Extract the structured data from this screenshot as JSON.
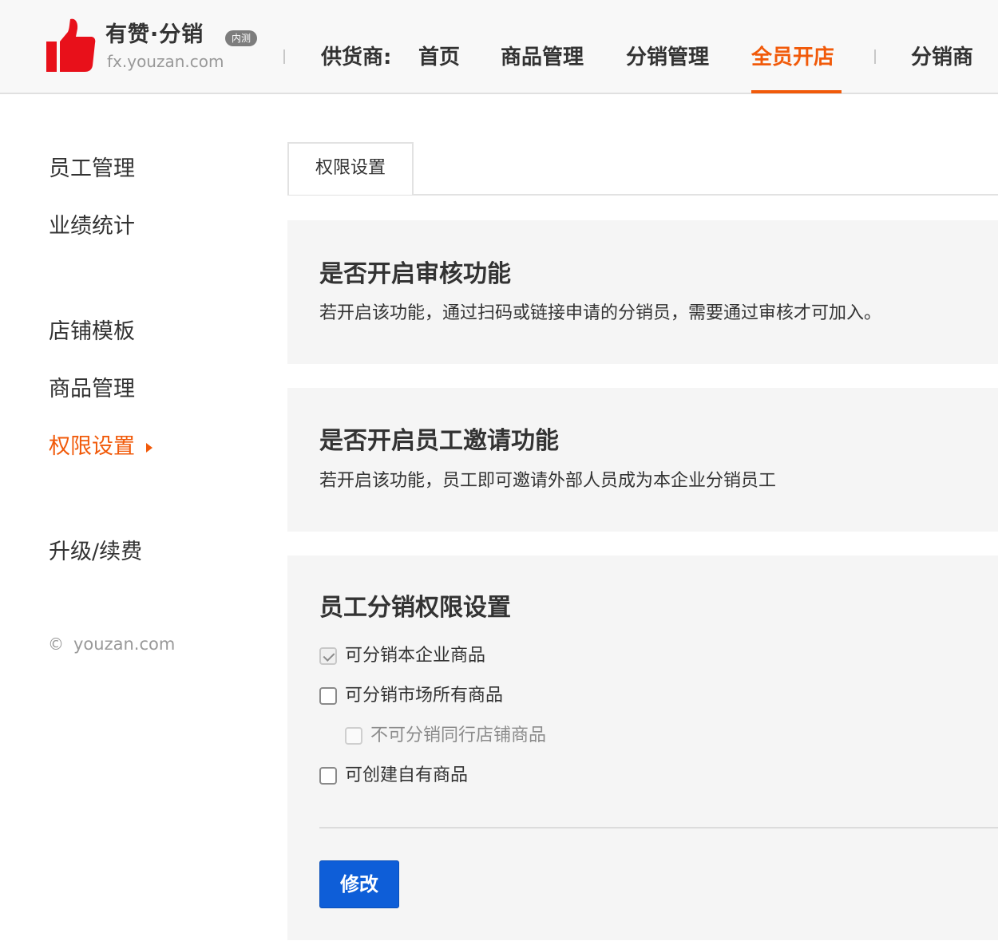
{
  "brand": {
    "name": "有赞·分销",
    "badge": "内测",
    "domain": "fx.youzan.com",
    "color": "#e8101a"
  },
  "nav": {
    "supplier_label": "供货商:",
    "items": [
      "首页",
      "商品管理",
      "分销管理",
      "全员开店",
      "分销商"
    ],
    "active_index": 3,
    "accent": "#f15a0a"
  },
  "sidebar": {
    "items": [
      "员工管理",
      "业绩统计",
      "店铺模板",
      "商品管理",
      "权限设置",
      "升级/续费"
    ],
    "active_index": 4,
    "copyright": "youzan.com"
  },
  "tabs": {
    "items": [
      "权限设置"
    ]
  },
  "sections": {
    "review": {
      "title": "是否开启审核功能",
      "desc": "若开启该功能，通过扫码或链接申请的分销员，需要通过审核才可加入。"
    },
    "invite": {
      "title": "是否开启员工邀请功能",
      "desc": "若开启该功能，员工即可邀请外部人员成为本企业分销员工"
    },
    "permissions": {
      "title": "员工分销权限设置",
      "options": [
        {
          "label": "可分销本企业商品",
          "checked": true,
          "disabled": true
        },
        {
          "label": "可分销市场所有商品",
          "checked": false,
          "disabled": false
        },
        {
          "label": "不可分销同行店铺商品",
          "checked": false,
          "disabled": true
        },
        {
          "label": "可创建自有商品",
          "checked": false,
          "disabled": false
        }
      ],
      "submit_label": "修改",
      "button_color": "#0e5ed8"
    }
  }
}
